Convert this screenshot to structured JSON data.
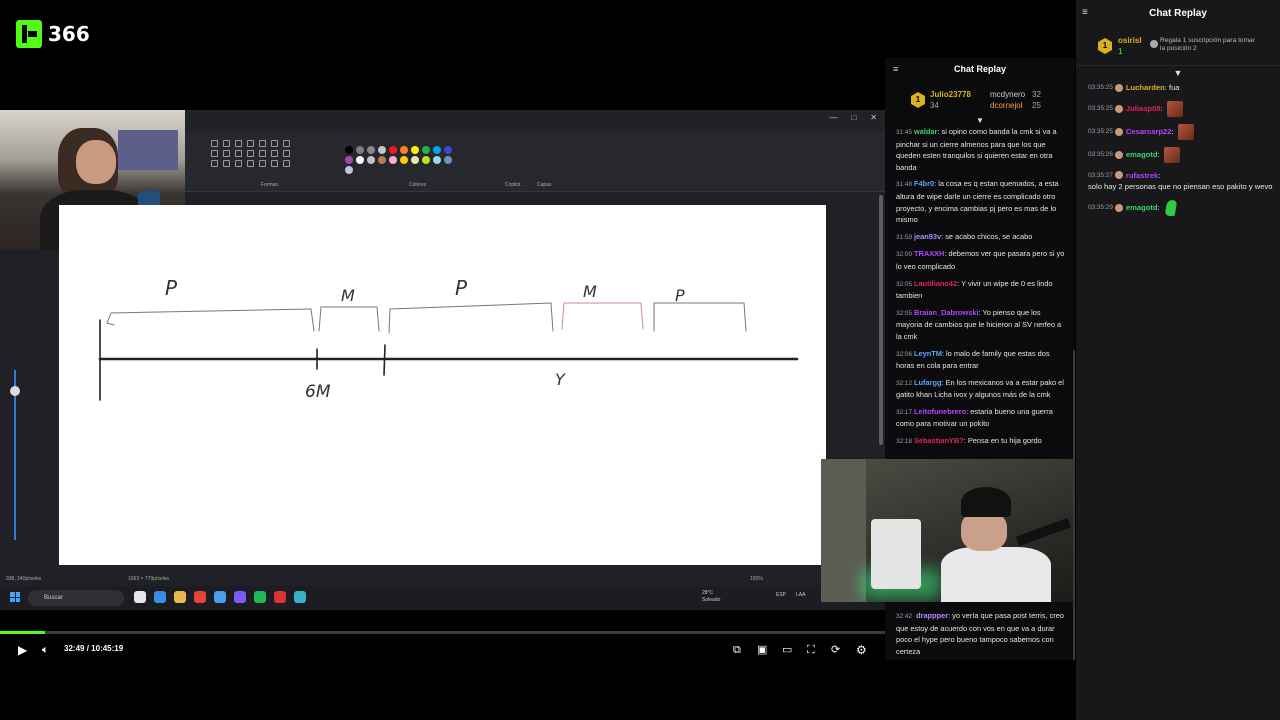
{
  "channel": {
    "viewer_count": "366",
    "brand_color": "#53fc18"
  },
  "paint": {
    "ribbon_labels": [
      "ieles",
      "Formas",
      "Colores",
      "Copilot",
      "Capas"
    ],
    "status_position": "938, 240píxeles",
    "status_size": "1663 × 779píxeles",
    "zoom": "100%",
    "colors": [
      "#000000",
      "#7f7f7f",
      "#888888",
      "#c3c3c3",
      "#ed1c24",
      "#ff7f27",
      "#fff200",
      "#22b14c",
      "#00a2e8",
      "#3f48cc",
      "#a349a4",
      "#ffffff",
      "#c3c3c3",
      "#b97a57",
      "#ffaec9",
      "#ffc90e",
      "#efe4b0",
      "#b5e61d",
      "#99d9ea",
      "#7092be",
      "#c8bfe7"
    ]
  },
  "sketch": {
    "letters": [
      "P",
      "M",
      "P",
      "M",
      "P",
      "6M",
      "Y"
    ]
  },
  "taskbar": {
    "search_placeholder": "Buscar",
    "weather_temp": "28°C",
    "weather_desc": "Soleado",
    "lang": "ESP",
    "lang2": "LAA"
  },
  "inner_chat": {
    "title": "Chat Replay",
    "gifters": [
      {
        "name": "Julio23778",
        "count": "34"
      },
      {
        "name": "mcdynero",
        "count": "32"
      },
      {
        "name": "dcornejol",
        "count": "25"
      }
    ],
    "messages": [
      {
        "time": "31:45",
        "user": "waldar",
        "color": "#3cd070",
        "text": "si opino como banda la cmk si va a pinchar si un cierre almenos para que los que queden esten tranquilos si quieren estar en otra banda"
      },
      {
        "time": "31:48",
        "user": "F4br0",
        "color": "#58a6ff",
        "text": "la cosa es q estan quemados, a esta altura de wipe darle un cierre es complicado otro proyecto, y encima cambias pj pero es mas de lo mismo"
      },
      {
        "time": "31:59",
        "user": "jean93v",
        "color": "#b38cff",
        "text": "se acabo chicos, se acabo"
      },
      {
        "time": "32:00",
        "user": "TRAXXH",
        "color": "#b146ff",
        "text": "debemos ver que pasara pero si yo lo veo complicado"
      },
      {
        "time": "32:05",
        "user": "Lautiliano42",
        "color": "#e0245e",
        "text": "Y vivir un wipe de 0 es lindo tambien"
      },
      {
        "time": "32:05",
        "user": "Braian_Dabrowski",
        "color": "#b146ff",
        "text": "Yo pienso que los mayoria de cambios que le hicieron al SV nerfeo a la cmk"
      },
      {
        "time": "32:06",
        "user": "LeynTM",
        "color": "#58a6ff",
        "text": "lo malo de family que estas dos horas en cola para entrar"
      },
      {
        "time": "32:12",
        "user": "Lufargg",
        "color": "#58a6ff",
        "text": "En los mexicanos va a estar pako el gatito khan Licha ivox y algunos más de la cmk"
      },
      {
        "time": "32:17",
        "user": "Leitofunebrero",
        "color": "#b146ff",
        "text": "estaria bueno una guerra como para motivar un pokito"
      },
      {
        "time": "32:18",
        "user": "SebastianYB?",
        "color": "#e0245e",
        "text": "Pensa en tu hija gordo"
      }
    ],
    "bottom_message": {
      "time": "32:42",
      "user": "drappper",
      "color": "#b38cff",
      "text": "yo vería que pasa post terris, creo que estoy de acuerdo con vos en que va a durar poco el hype pero bueno tampoco sabemos con certeza"
    }
  },
  "player": {
    "current_time": "32:49",
    "separator": "/",
    "duration": "10:45:19",
    "progress_fraction": 0.051
  },
  "outer_chat": {
    "title": "Chat Replay",
    "gifter": {
      "name": "osirisl",
      "count": "1",
      "note": "Regala 1 suscripción para tomar la posición 2"
    },
    "messages": [
      {
        "time": "03:35:25",
        "user": "Lucharden",
        "color": "#d9b21f",
        "text": "fua",
        "emote": ""
      },
      {
        "time": "03:35:25",
        "user": "Juliasp08",
        "color": "#e0245e",
        "text": "",
        "emote": "brown"
      },
      {
        "time": "03:35:25",
        "user": "Cesarcarp22",
        "color": "#b146ff",
        "text": "",
        "emote": "brown"
      },
      {
        "time": "03:35:26",
        "user": "emagotd",
        "color": "#3cd070",
        "text": "",
        "emote": "brown"
      },
      {
        "time": "03:35:27",
        "user": "rufastrek",
        "color": "#b146ff",
        "text": "solo hay 2 personas que no piensan eso pakito y wevo",
        "emote": ""
      },
      {
        "time": "03:35:29",
        "user": "emagotd",
        "color": "#3cd070",
        "text": "",
        "emote": "green"
      }
    ]
  }
}
